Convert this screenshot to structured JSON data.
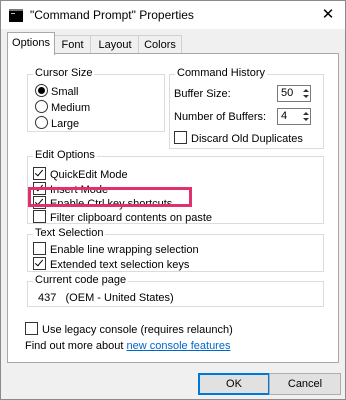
{
  "window": {
    "title": "\"Command Prompt\" Properties",
    "close_glyph": "✕"
  },
  "tabs": [
    {
      "label": "Options",
      "active": true
    },
    {
      "label": "Font",
      "active": false
    },
    {
      "label": "Layout",
      "active": false
    },
    {
      "label": "Colors",
      "active": false
    }
  ],
  "cursor_size": {
    "title": "Cursor Size",
    "options": [
      {
        "label": "Small",
        "selected": true
      },
      {
        "label": "Medium",
        "selected": false
      },
      {
        "label": "Large",
        "selected": false
      }
    ]
  },
  "command_history": {
    "title": "Command History",
    "buffer_size_label": "Buffer Size:",
    "buffer_size_value": "50",
    "num_buffers_label": "Number of Buffers:",
    "num_buffers_value": "4",
    "discard_label": "Discard Old Duplicates",
    "discard_checked": false
  },
  "edit_options": {
    "title": "Edit Options",
    "items": [
      {
        "label": "QuickEdit Mode",
        "checked": true
      },
      {
        "label": "Insert Mode",
        "checked": true
      },
      {
        "label": "Enable Ctrl key shortcuts",
        "checked": true
      },
      {
        "label": "Filter clipboard contents on paste",
        "checked": false
      }
    ]
  },
  "text_selection": {
    "title": "Text Selection",
    "items": [
      {
        "label": "Enable line wrapping selection",
        "checked": false
      },
      {
        "label": "Extended text selection keys",
        "checked": true
      }
    ]
  },
  "code_page": {
    "title": "Current code page",
    "value": "437   (OEM - United States)"
  },
  "legacy": {
    "label": "Use legacy console (requires relaunch)",
    "checked": false
  },
  "footer": {
    "find_text": "Find out more about ",
    "link_text": "new console features"
  },
  "buttons": {
    "ok": "OK",
    "cancel": "Cancel"
  },
  "colors": {
    "highlight_border": "#e0306f",
    "link": "#0066cc",
    "default_button_border": "#0078d7"
  }
}
